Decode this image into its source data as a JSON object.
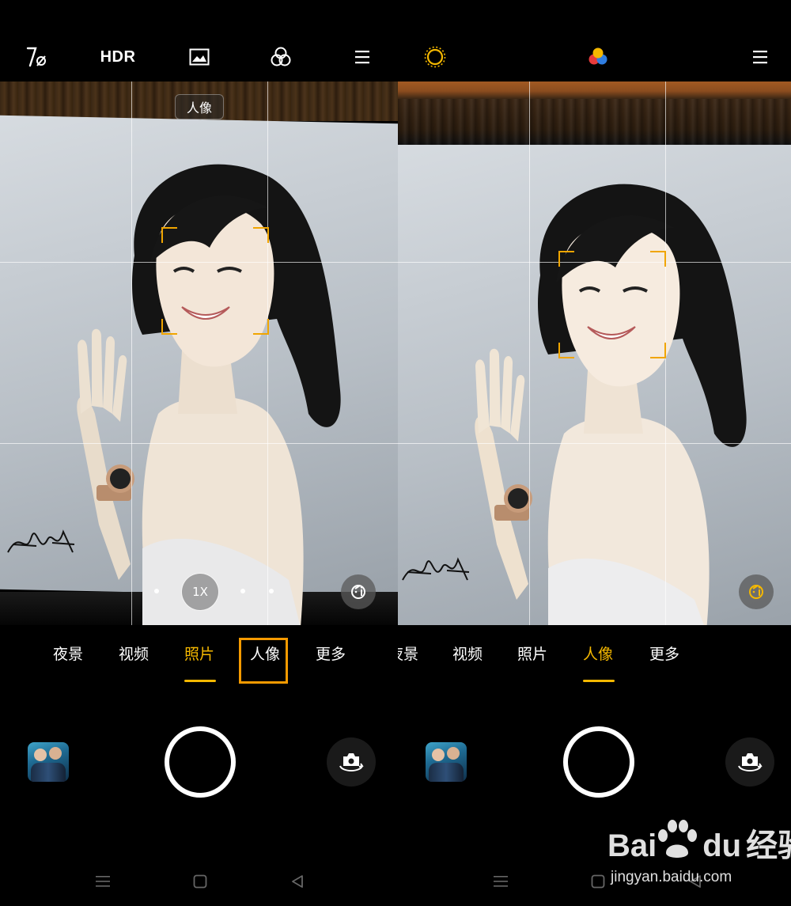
{
  "left": {
    "top_bar": {
      "flash_icon": "flash-auto-icon",
      "hdr_label": "HDR",
      "ai_scene_icon": "image-icon",
      "filter_icon": "filter-icon",
      "menu_icon": "menu-icon"
    },
    "viewfinder": {
      "mode_chip_label": "人像",
      "zoom_label": "1X",
      "beauty_icon": "beauty-face-icon"
    },
    "modes": [
      {
        "label": "夜景",
        "active": false
      },
      {
        "label": "视频",
        "active": false
      },
      {
        "label": "照片",
        "active": true
      },
      {
        "label": "人像",
        "active": false,
        "highlighted": true
      },
      {
        "label": "更多",
        "active": false
      }
    ],
    "accent_color": "#f5b800",
    "highlight_color": "#f59a00"
  },
  "right": {
    "top_bar": {
      "light_icon": "sun-icon",
      "color_icon": "color-dots-icon",
      "menu_icon": "menu-icon"
    },
    "viewfinder": {
      "beauty_icon": "beauty-face-icon"
    },
    "modes": [
      {
        "label": "夜景",
        "active": false
      },
      {
        "label": "视频",
        "active": false
      },
      {
        "label": "照片",
        "active": false
      },
      {
        "label": "人像",
        "active": true
      },
      {
        "label": "更多",
        "active": false
      }
    ]
  },
  "watermark": {
    "brand": "Bai du 经验",
    "brand_bai": "Bai",
    "brand_du": "du",
    "brand_jingyan": "经验",
    "url": "jingyan.baidu.com"
  }
}
